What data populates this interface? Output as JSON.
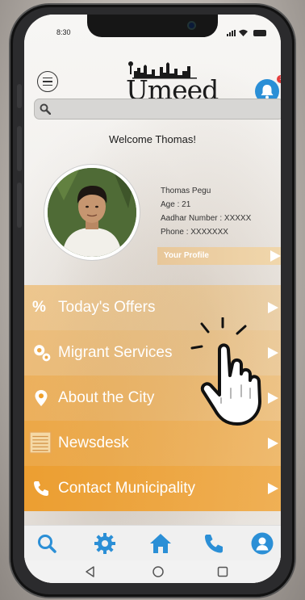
{
  "status_bar": {
    "time": "8:30"
  },
  "header": {
    "logo_text": "Umeed",
    "notification_count": "1"
  },
  "search": {
    "placeholder": ""
  },
  "welcome_text": "Welcome Thomas!",
  "profile": {
    "name": "Thomas Pegu",
    "age": "Age : 21",
    "aadhar": "Aadhar Number : XXXXX",
    "phone": "Phone : XXXXXXX",
    "button_label": "Your Profile"
  },
  "menu": [
    {
      "label": "Today's Offers",
      "icon": "percent-icon"
    },
    {
      "label": "Migrant Services",
      "icon": "gears-icon"
    },
    {
      "label": "About the City",
      "icon": "location-pin-icon"
    },
    {
      "label": "Newsdesk",
      "icon": "newspaper-icon"
    },
    {
      "label": "Contact Municipality",
      "icon": "phone-icon"
    }
  ],
  "tab_bar": [
    "search-icon",
    "settings-icon",
    "home-icon",
    "phone-icon",
    "user-icon"
  ],
  "system_nav": [
    "back-icon",
    "home-circle-icon",
    "recents-icon"
  ],
  "colors": {
    "accent_orange": "#ef9f2a",
    "accent_blue": "#2b8fd6"
  }
}
